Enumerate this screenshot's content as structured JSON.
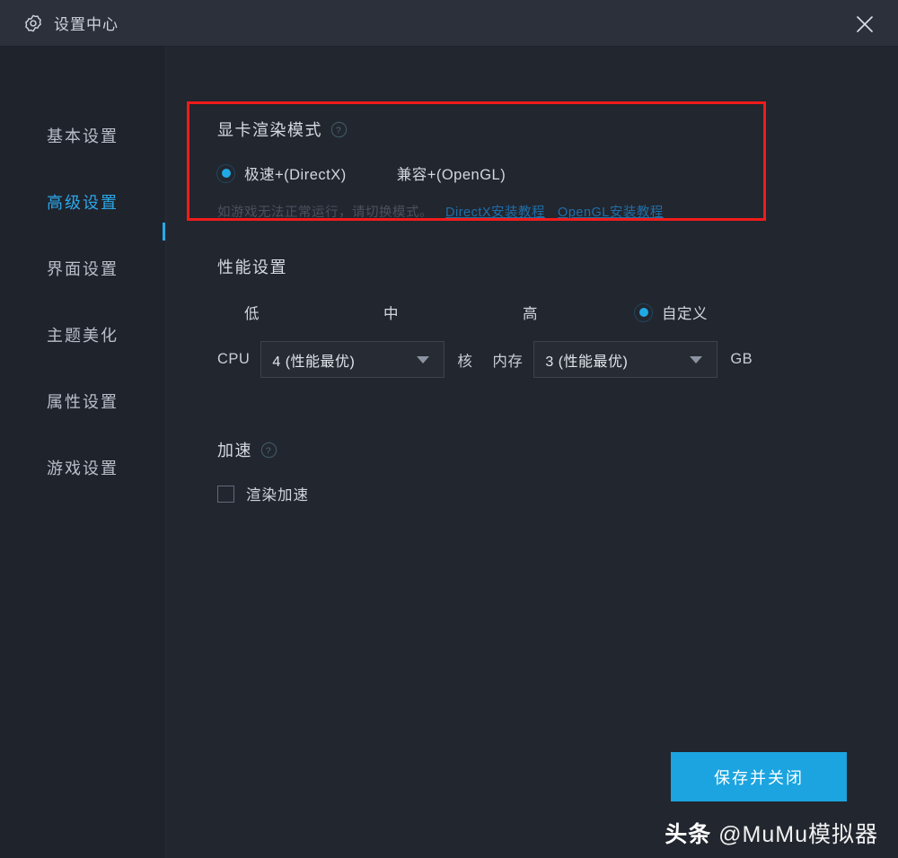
{
  "window": {
    "title": "设置中心",
    "gear_icon": "gear-icon",
    "close_icon": "close-icon"
  },
  "sidebar": {
    "items": [
      {
        "label": "基本设置",
        "active": false
      },
      {
        "label": "高级设置",
        "active": true
      },
      {
        "label": "界面设置",
        "active": false
      },
      {
        "label": "主题美化",
        "active": false
      },
      {
        "label": "属性设置",
        "active": false
      },
      {
        "label": "游戏设置",
        "active": false
      }
    ]
  },
  "render_mode": {
    "title": "显卡渲染模式",
    "help_icon": "help-circle-icon",
    "options": [
      {
        "label": "极速+(DirectX)",
        "selected": true
      },
      {
        "label": "兼容+(OpenGL)",
        "selected": false
      }
    ],
    "hint": "如游戏无法正常运行，请切换模式。",
    "links": [
      {
        "label": "DirectX安装教程"
      },
      {
        "label": "OpenGL安装教程"
      }
    ]
  },
  "performance": {
    "title": "性能设置",
    "options": [
      {
        "label": "低",
        "selected": false
      },
      {
        "label": "中",
        "selected": false
      },
      {
        "label": "高",
        "selected": false
      },
      {
        "label": "自定义",
        "selected": true
      }
    ],
    "cpu": {
      "label": "CPU",
      "value": "4 (性能最优)",
      "unit": "核",
      "caret_icon": "chevron-down-icon"
    },
    "memory": {
      "label": "内存",
      "value": "3 (性能最优)",
      "unit": "GB",
      "caret_icon": "chevron-down-icon"
    }
  },
  "acceleration": {
    "title": "加速",
    "help_icon": "help-circle-icon",
    "checkbox": {
      "label": "渲染加速",
      "checked": false
    }
  },
  "footer": {
    "save_label": "保存并关闭"
  },
  "watermark": {
    "prefix": "头条",
    "handle": "@MuMu模拟器"
  },
  "colors": {
    "accent": "#1ba4e0",
    "highlight": "#f01b1b",
    "titlebar_bg": "#2b303b",
    "sidebar_bg": "#1f232c",
    "content_bg": "#22262f",
    "link": "#1f6fa8"
  }
}
